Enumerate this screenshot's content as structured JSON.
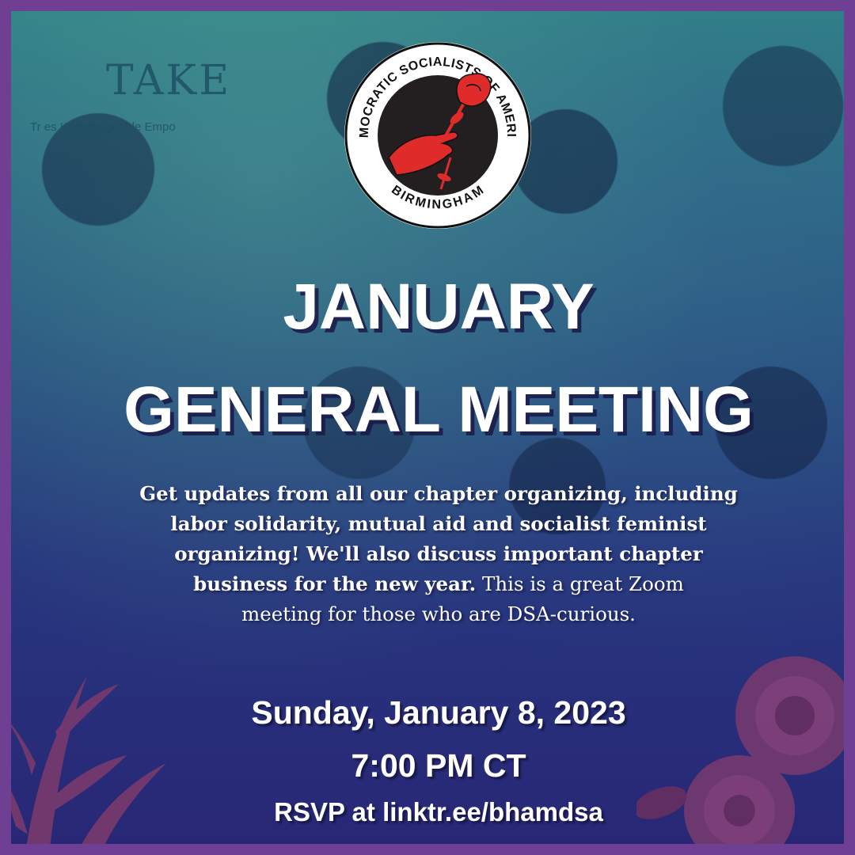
{
  "background": {
    "sign_text": "TAKE",
    "sign_subtext": "Tr          es Knowledgeable Empo",
    "frame_color": "#6f3f94",
    "accent_red": "#e02b2b"
  },
  "logo": {
    "top_arc": "DEMOCRATIC SOCIALISTS OF AMERICA",
    "bottom_arc": "BIRMINGHAM",
    "icon": "rose-in-hand-icon"
  },
  "title": {
    "line1": "JANUARY",
    "line2": "GENERAL MEETING"
  },
  "description": {
    "bold_line1": "Get updates from all our chapter organizing, including",
    "bold_line2": "labor solidarity, mutual aid and socialist feminist",
    "bold_line3": "organizing! We'll also discuss important chapter",
    "bold_line4": "business for the new year.",
    "regular_line4": " This is a great Zoom",
    "regular_line5": "meeting for those who are DSA-curious."
  },
  "event": {
    "date": "Sunday, January 8, 2023",
    "time": "7:00 PM CT",
    "rsvp": "RSVP at linktr.ee/bhamdsa"
  }
}
